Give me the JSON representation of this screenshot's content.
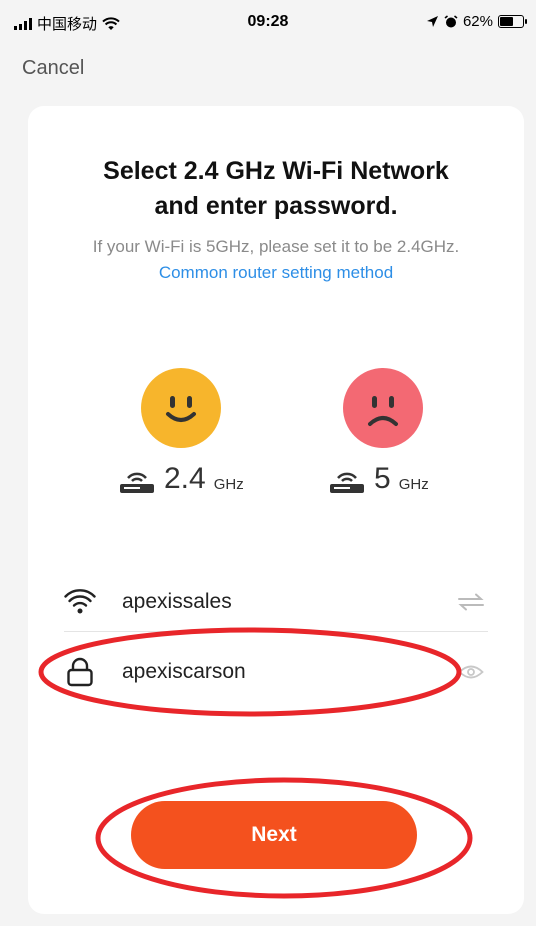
{
  "status_bar": {
    "carrier": "中国移动",
    "time": "09:28",
    "battery": "62%",
    "battery_level": 0.62
  },
  "nav": {
    "cancel_label": "Cancel"
  },
  "dialog": {
    "title_line1": "Select 2.4 GHz Wi-Fi Network",
    "title_line2": "and enter password.",
    "hint_text": "If your Wi-Fi is 5GHz, please set it to be 2.4GHz.",
    "hint_link": "Common router setting method"
  },
  "bands": {
    "supported": {
      "value": "2.4",
      "unit": "GHz",
      "face": "happy-face-icon",
      "color": "#f7b52c"
    },
    "unsupported": {
      "value": "5",
      "unit": "GHz",
      "face": "sad-face-icon",
      "color": "#f36973"
    }
  },
  "form": {
    "ssid_value": "apexissales",
    "password_value": "apexiscarson"
  },
  "next_label": "Next",
  "colors": {
    "accent": "#f4511e",
    "link": "#2d8ee6",
    "annotation": "#e8262a"
  }
}
